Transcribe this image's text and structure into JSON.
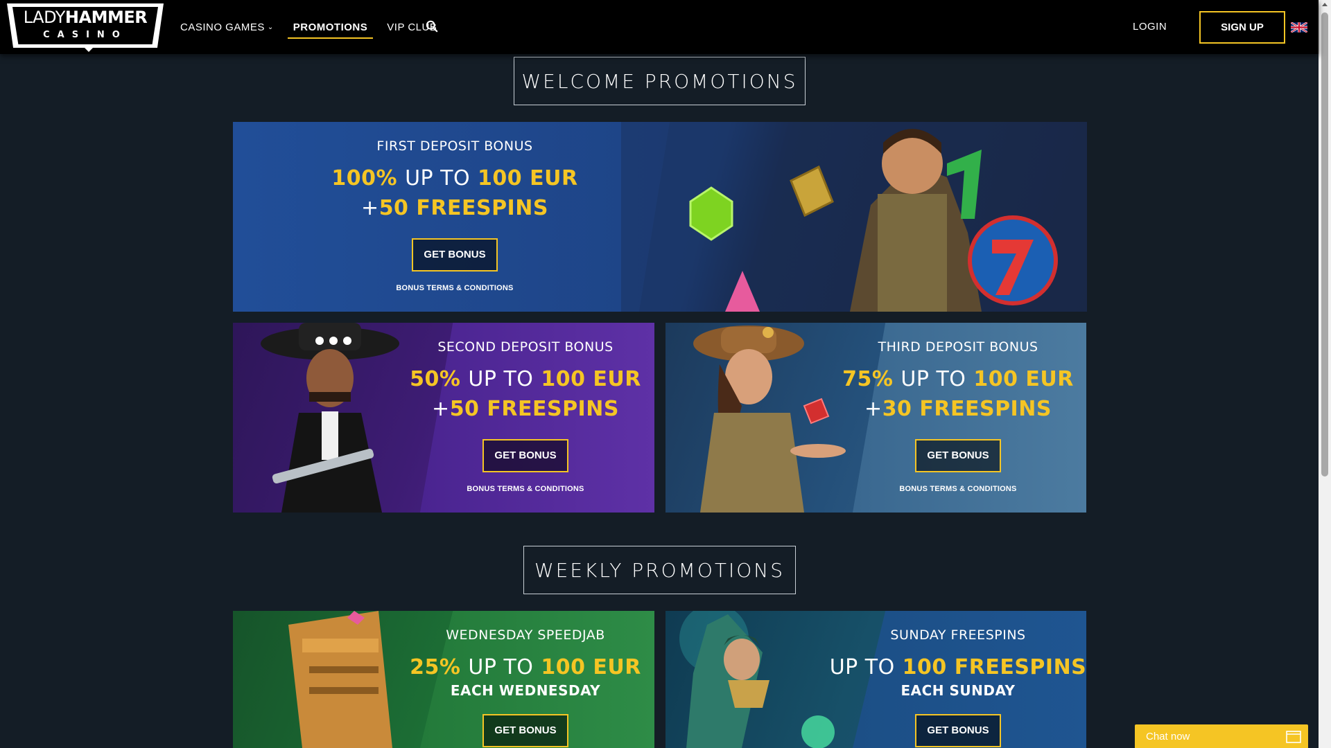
{
  "brand": {
    "logo_word_thin": "LADY",
    "logo_word_bold": "HAMMER",
    "logo_sub": "CASINO",
    "accent_color": "#f5c524"
  },
  "nav": {
    "items": [
      {
        "label": "CASINO GAMES",
        "has_dropdown": true
      },
      {
        "label": "PROMOTIONS",
        "active": true
      },
      {
        "label": "VIP CLUB"
      }
    ],
    "search_icon": "search-icon",
    "login_label": "LOGIN",
    "signup_label": "SIGN UP",
    "language_flag": "uk-flag-icon"
  },
  "sections": {
    "welcome_title": "WELCOME PROMOTIONS",
    "weekly_title": "WEEKLY PROMOTIONS"
  },
  "promos": [
    {
      "title": "FIRST DEPOSIT BONUS",
      "pct": "100%",
      "upto": "UP TO",
      "amount": "100 EUR",
      "plus": "+",
      "spins": "50 FREESPINS",
      "button": "GET BONUS",
      "terms": "BONUS TERMS & CONDITIONS"
    },
    {
      "title": "SECOND DEPOSIT BONUS",
      "pct": "50%",
      "upto": "UP TO",
      "amount": "100 EUR",
      "plus": "+",
      "spins": "50 FREESPINS",
      "button": "GET BONUS",
      "terms": "BONUS TERMS & CONDITIONS"
    },
    {
      "title": "THIRD DEPOSIT BONUS",
      "pct": "75%",
      "upto": "UP TO",
      "amount": "100 EUR",
      "plus": "+",
      "spins": "30 FREESPINS",
      "button": "GET BONUS",
      "terms": "BONUS TERMS & CONDITIONS"
    },
    {
      "title": "WEDNESDAY SPEEDJAB",
      "pct": "25%",
      "upto": "UP TO",
      "amount": "100 EUR",
      "subline": "EACH WEDNESDAY",
      "button": "GET BONUS"
    },
    {
      "title": "SUNDAY FREESPINS",
      "upto": "UP TO",
      "amount": "100 FREESPINS",
      "subline": "EACH SUNDAY",
      "button": "GET BONUS"
    }
  ],
  "chat": {
    "label": "Chat now"
  }
}
